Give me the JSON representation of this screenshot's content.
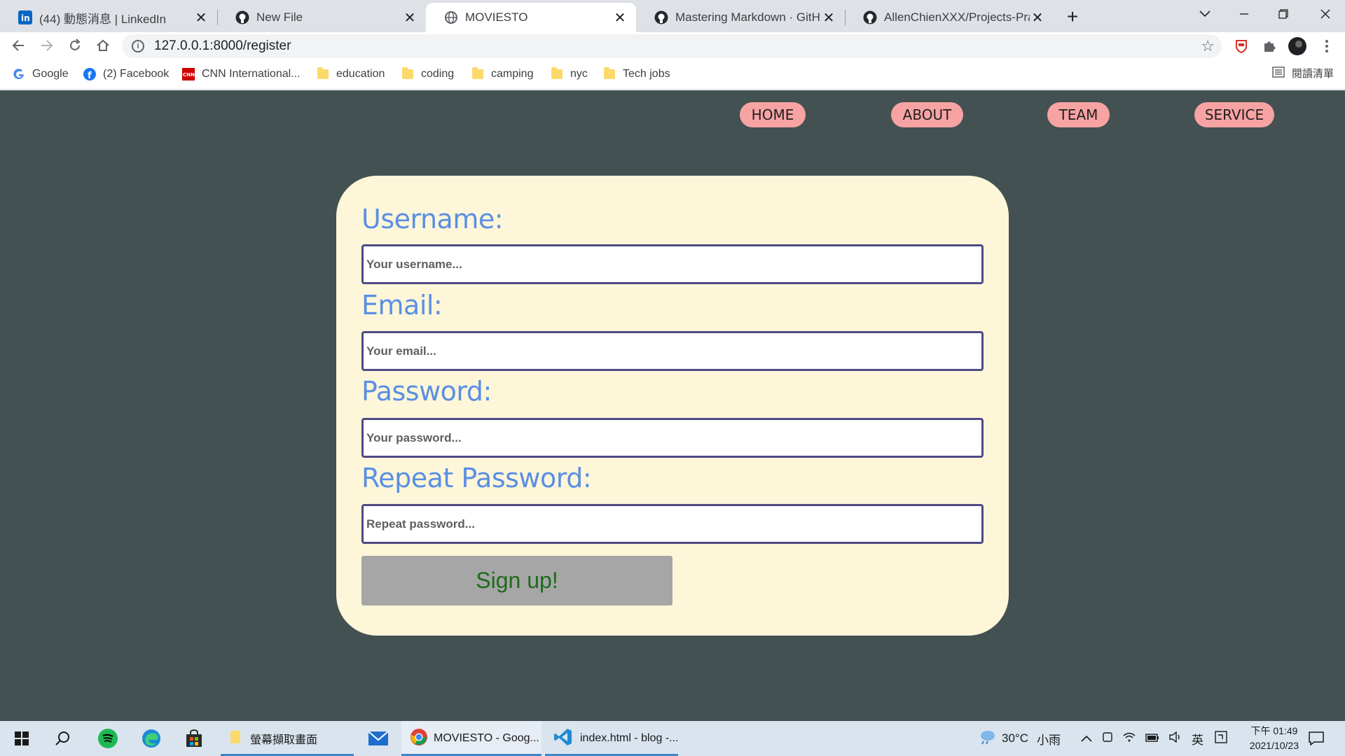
{
  "browser": {
    "tabs": [
      {
        "title": "(44) 動態消息 | LinkedIn",
        "icon": "linkedin-icon"
      },
      {
        "title": "New File",
        "icon": "github-icon"
      },
      {
        "title": "MOVIESTO",
        "icon": "globe-icon",
        "active": true
      },
      {
        "title": "Mastering Markdown · GitHub",
        "icon": "github-icon"
      },
      {
        "title": "AllenChienXXX/Projects-Practice",
        "icon": "github-icon"
      }
    ],
    "close_glyph": "✕",
    "new_tab_glyph": "+",
    "url": "127.0.0.1:8000/register",
    "bookmarks": [
      {
        "label": "Google",
        "icon": "google-icon"
      },
      {
        "label": "(2) Facebook",
        "icon": "facebook-icon"
      },
      {
        "label": "CNN International...",
        "icon": "cnn-icon"
      },
      {
        "label": "education",
        "icon": "folder-icon"
      },
      {
        "label": "coding",
        "icon": "folder-icon"
      },
      {
        "label": "camping",
        "icon": "folder-icon"
      },
      {
        "label": "nyc",
        "icon": "folder-icon"
      },
      {
        "label": "Tech jobs",
        "icon": "folder-icon"
      }
    ],
    "reading_list": "閱讀清單"
  },
  "site": {
    "nav": [
      "HOME",
      "ABOUT",
      "TEAM",
      "SERVICE"
    ],
    "form": {
      "username_label": "Username:",
      "username_placeholder": "Your username...",
      "email_label": "Email:",
      "email_placeholder": "Your email...",
      "password_label": "Password:",
      "password_placeholder": "Your password...",
      "repeat_label": "Repeat Password:",
      "repeat_placeholder": "Repeat password...",
      "submit": "Sign up!"
    },
    "colors": {
      "page_bg": "#435152",
      "card_bg": "#fef6d9",
      "nav_pill": "#f7a3a3",
      "label": "#5a8fe3",
      "input_border": "#4f4b83",
      "button_bg": "#a6a6a6",
      "button_text": "#1e6b1e"
    }
  },
  "taskbar": {
    "apps": [
      {
        "label": "螢幕擷取畫面",
        "icon": "folder-icon"
      },
      {
        "label": "MOVIESTO - Goog...",
        "icon": "chrome-icon"
      },
      {
        "label": "index.html - blog -...",
        "icon": "vscode-icon"
      }
    ],
    "weather": "30°C",
    "weather_desc": "小雨",
    "ime": "英",
    "time": "下午 01:49",
    "date": "2021/10/23"
  }
}
